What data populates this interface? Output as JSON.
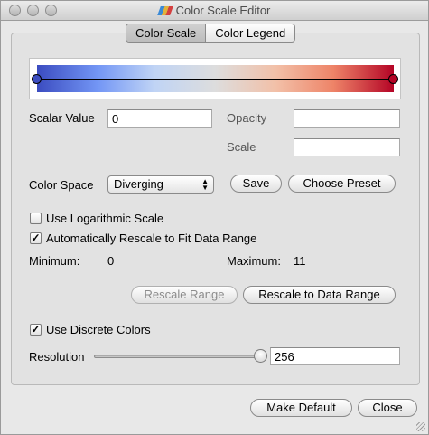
{
  "window": {
    "title": "Color Scale Editor"
  },
  "tabs": [
    {
      "label": "Color Scale",
      "active": true
    },
    {
      "label": "Color Legend",
      "active": false
    }
  ],
  "colormap": {
    "stops": [
      "#3b4cc0",
      "#7396f5",
      "#c0d4f5",
      "#dddddd",
      "#f2c0a8",
      "#ee8468",
      "#b40426"
    ],
    "left_handle_color": "#3b4cc0",
    "right_handle_color": "#b40426"
  },
  "scalar": {
    "label": "Scalar Value",
    "value": "0"
  },
  "opacity": {
    "label": "Opacity",
    "value": ""
  },
  "scale": {
    "label": "Scale",
    "value": ""
  },
  "color_space": {
    "label": "Color Space",
    "value": "Diverging"
  },
  "buttons": {
    "save": "Save",
    "choose_preset": "Choose Preset",
    "rescale_range": "Rescale Range",
    "rescale_to_data_range": "Rescale to Data Range",
    "make_default": "Make Default",
    "close": "Close"
  },
  "options": {
    "log_scale": {
      "label": "Use Logarithmic Scale",
      "checked": false
    },
    "auto_rescale": {
      "label": "Automatically Rescale to Fit Data Range",
      "checked": true
    },
    "discrete": {
      "label": "Use Discrete Colors",
      "checked": true
    }
  },
  "range": {
    "min_label": "Minimum:",
    "min_value": "0",
    "max_label": "Maximum:",
    "max_value": "11"
  },
  "resolution": {
    "label": "Resolution",
    "value": "256",
    "slider_fraction": 0.98
  }
}
